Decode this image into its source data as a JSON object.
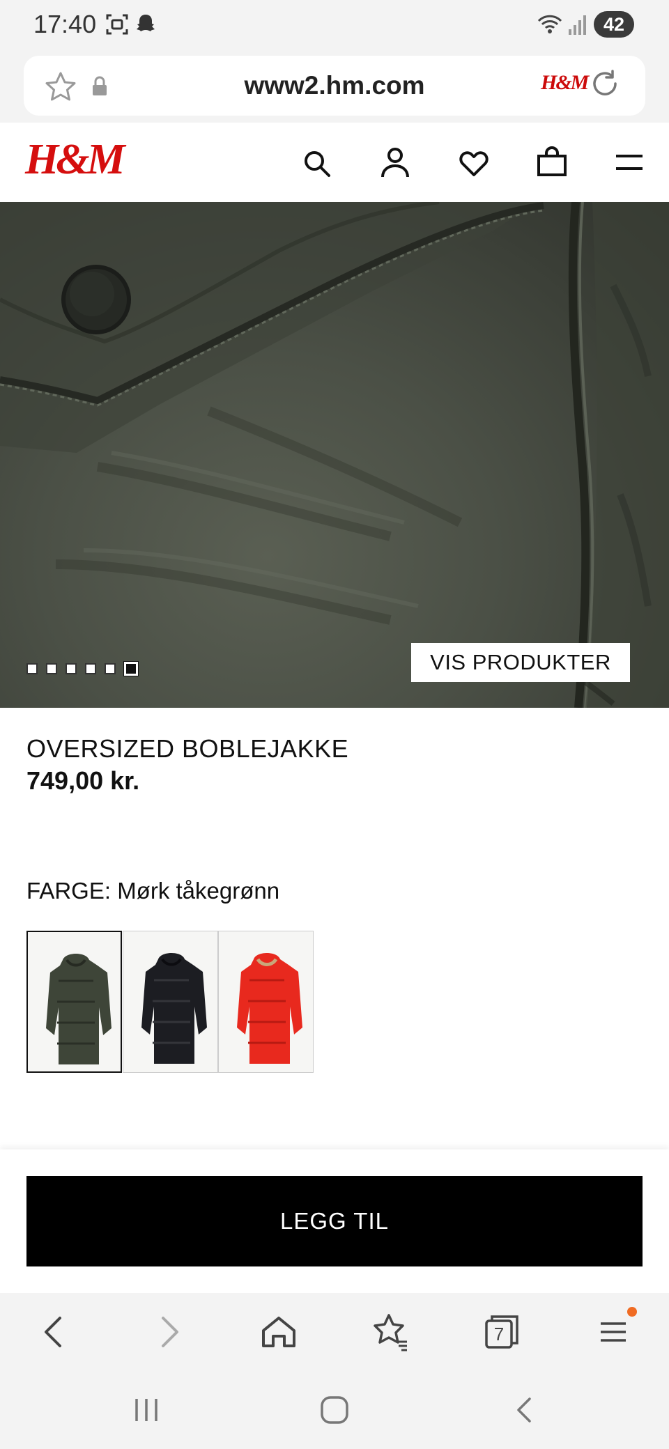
{
  "status_bar": {
    "time": "17:40",
    "battery": "42"
  },
  "browser": {
    "url": "www2.hm.com",
    "url_logo": "H&M"
  },
  "site": {
    "logo": "H&M"
  },
  "hero": {
    "cta_label": "VIS PRODUKTER",
    "slide_count": 6,
    "active_slide": 6
  },
  "product": {
    "name": "OVERSIZED BOBLEJAKKE",
    "price": "749,00 kr.",
    "color_label": "FARGE: Mørk tåkegrønn",
    "swatches": [
      {
        "name": "dark-green",
        "color": "#3e4538",
        "selected": true
      },
      {
        "name": "black",
        "color": "#1c1d22",
        "selected": false
      },
      {
        "name": "red",
        "color": "#e8291e",
        "selected": false
      }
    ]
  },
  "cart": {
    "add_label": "LEGG TIL"
  },
  "browser_nav": {
    "tabs_count": "7"
  },
  "colors": {
    "brand_red": "#d50e0e",
    "badge_orange": "#f06b22"
  }
}
